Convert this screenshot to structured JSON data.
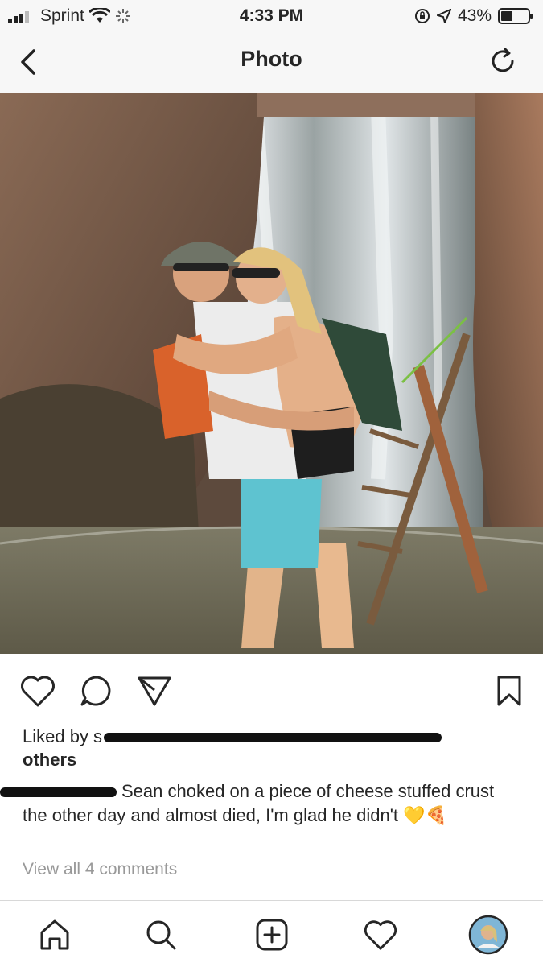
{
  "status_bar": {
    "carrier": "Sprint",
    "time": "4:33 PM",
    "battery": "43%",
    "battery_level": 0.43
  },
  "nav": {
    "title": "Photo",
    "back_icon": "chevron-left-icon",
    "refresh_icon": "refresh-icon"
  },
  "post": {
    "likes_prefix": "Liked by s",
    "likes_others": "others",
    "caption_text": "Sean choked on a piece of cheese stuffed crust the other day and almost died, I'm glad he didn't",
    "caption_emoji": "💛🍕",
    "view_comments": "View all 4 comments"
  },
  "tabs": [
    {
      "name": "home",
      "icon": "home-icon"
    },
    {
      "name": "search",
      "icon": "search-icon"
    },
    {
      "name": "new-post",
      "icon": "plus-square-icon"
    },
    {
      "name": "activity",
      "icon": "heart-icon"
    },
    {
      "name": "profile",
      "icon": "avatar-icon"
    }
  ]
}
